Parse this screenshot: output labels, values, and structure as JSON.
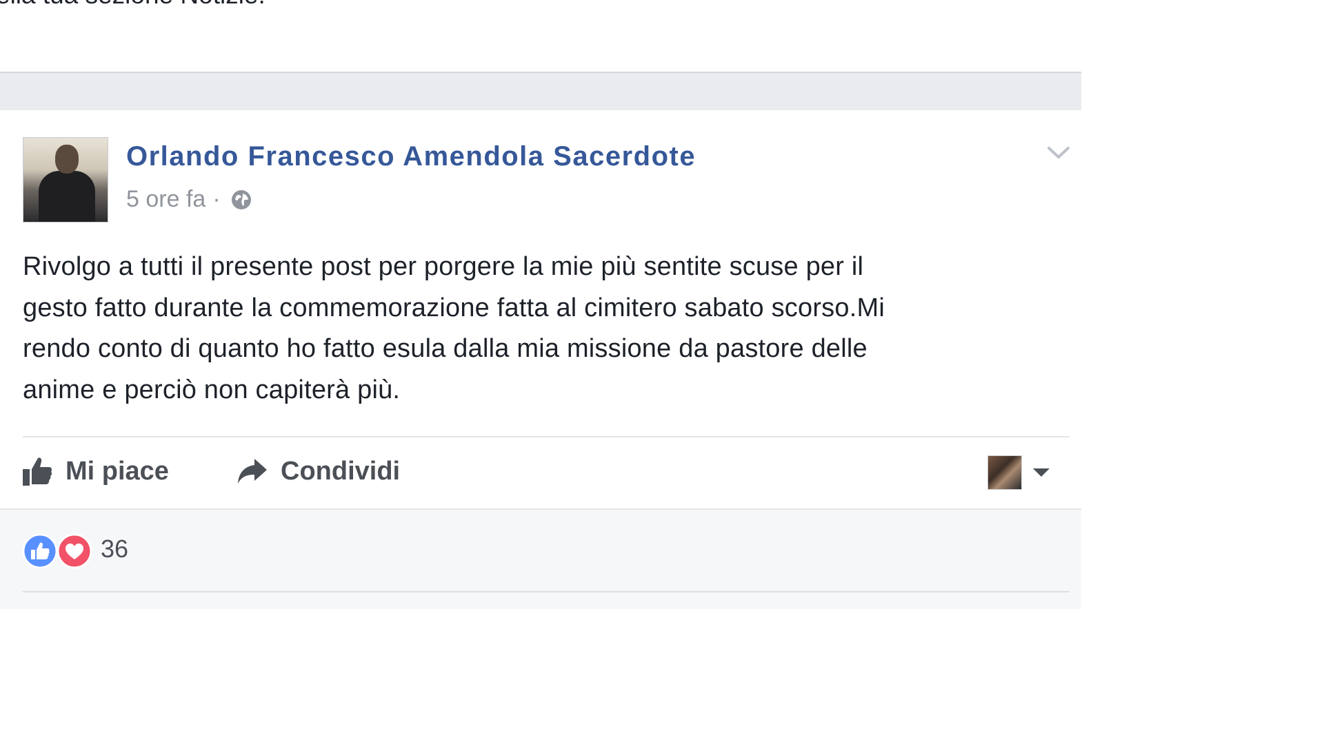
{
  "notice": {
    "text": "ella tua sezione Notizie."
  },
  "post": {
    "author": "Orlando Francesco Amendola Sacerdote",
    "timestamp": "5 ore fa",
    "meta_separator": "·",
    "privacy_icon": "globe-icon",
    "menu_icon": "chevron-down-icon",
    "body_lines": [
      "Rivolgo a tutti il presente post per porgere la mie più sentite scuse per il",
      "gesto fatto durante la commemorazione fatta al cimitero sabato scorso.Mi",
      "rendo conto di quanto ho fatto esula dalla mia missione da pastore delle",
      "anime e perciò non capiterà più."
    ]
  },
  "actions": {
    "like_label": "Mi piace",
    "like_icon": "thumbs-up-icon",
    "share_label": "Condividi",
    "share_icon": "share-arrow-icon",
    "selector_icon": "profile-avatar",
    "selector_caret": "caret-down-icon"
  },
  "reactions": {
    "icons": [
      "like-reaction-icon",
      "love-reaction-icon"
    ],
    "count": "36"
  },
  "colors": {
    "link_blue": "#365899",
    "text": "#1d2129",
    "muted": "#90949c",
    "action_text": "#4b4f56",
    "like_blue": "#5890ff",
    "love_red": "#f25268",
    "feed_bg": "#e9ebee"
  }
}
